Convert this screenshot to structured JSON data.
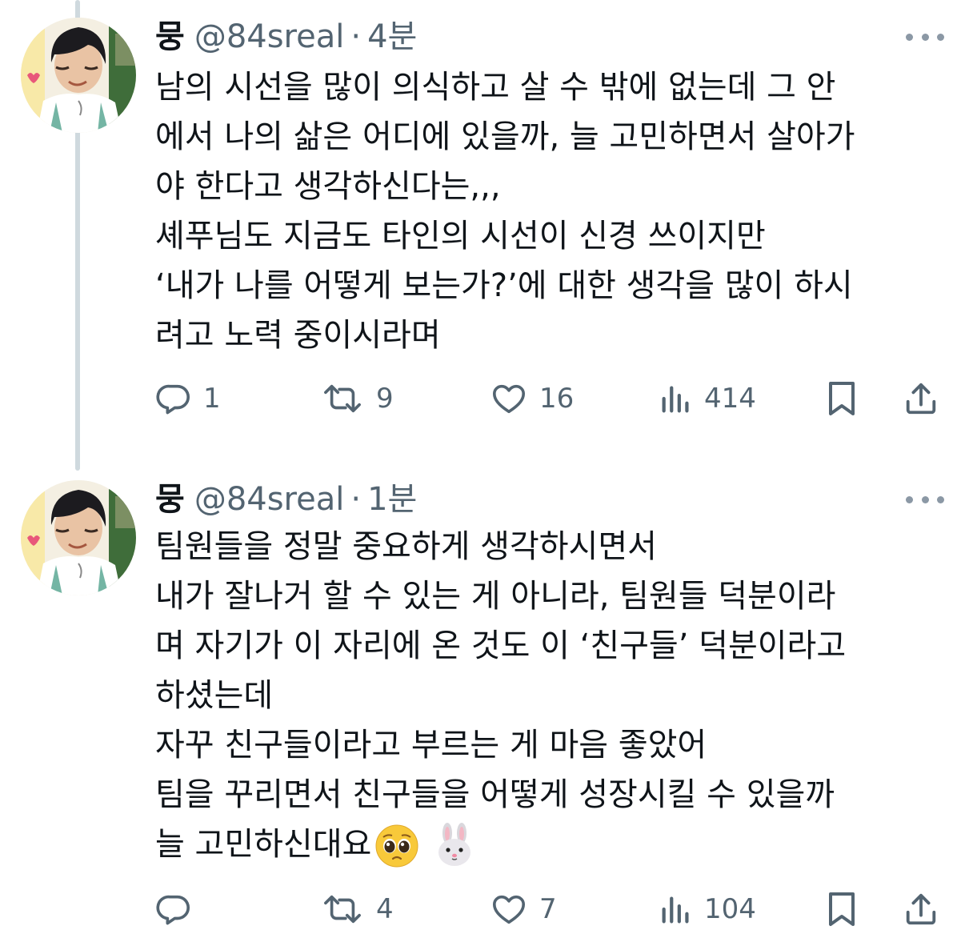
{
  "tweets": [
    {
      "display_name": "뭉",
      "handle": "@84sreal",
      "separator": "·",
      "time": "4분",
      "lines": [
        "남의 시선을 많이 의식하고 살 수 밖에 없는데 그 안",
        "에서 나의 삶은 어디에 있을까, 늘 고민하면서 살아가",
        "야 한다고 생각하신다는,,,",
        "셰푸님도 지금도 타인의 시선이 신경 쓰이지만",
        "‘내가 나를 어떻게 보는가?’에 대한 생각을 많이 하시",
        "려고 노력 중이시라며"
      ],
      "replies": "1",
      "reposts": "9",
      "likes": "16",
      "views": "414"
    },
    {
      "display_name": "뭉",
      "handle": "@84sreal",
      "separator": "·",
      "time": "1분",
      "lines": [
        "팀원들을 정말 중요하게 생각하시면서",
        "내가 잘나거 할 수 있는 게 아니라, 팀원들 덕분이라",
        "며 자기가 이 자리에 온 것도 이 ‘친구들’ 덕분이라고",
        "하셨는데",
        "자꾸 친구들이라고 부르는 게 마음 좋았어",
        "팀을 꾸리면서 친구들을 어떻게 성장시킬 수 있을까",
        "늘 고민하신대요"
      ],
      "replies": "",
      "reposts": "4",
      "likes": "7",
      "views": "104"
    }
  ],
  "icons": {
    "reply": "reply-icon",
    "repost": "repost-icon",
    "like": "heart-icon",
    "views": "views-icon",
    "bookmark": "bookmark-icon",
    "share": "share-icon",
    "more": "more-icon",
    "emojis": [
      "pleading-face-emoji",
      "rabbit-face-emoji"
    ]
  },
  "colors": {
    "text": "#0f1419",
    "secondary": "#536471",
    "thread_line": "#cfd9de"
  }
}
